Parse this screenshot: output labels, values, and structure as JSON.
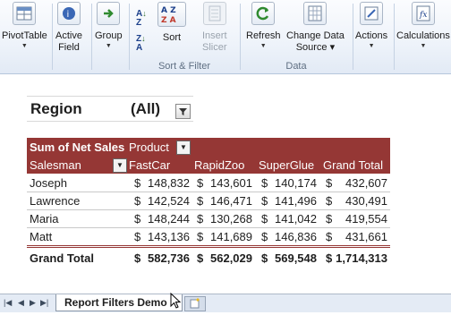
{
  "ribbon": {
    "pivottable": "PivotTable",
    "active_field_1": "Active",
    "active_field_2": "Field",
    "group": "Group",
    "sort": "Sort",
    "insert_slicer_1": "Insert",
    "insert_slicer_2": "Slicer",
    "refresh": "Refresh",
    "change_source_1": "Change Data",
    "change_source_2": "Source",
    "actions": "Actions",
    "calculations": "Calculations",
    "group_sort_filter": "Sort & Filter",
    "group_data": "Data"
  },
  "pivot": {
    "filter_label": "Region",
    "filter_value": "(All)",
    "header_values": "Sum of Net Sales",
    "header_columns": "Product",
    "row_field": "Salesman",
    "columns": [
      "FastCar",
      "RapidZoo",
      "SuperGlue",
      "Grand Total"
    ],
    "currency": "$",
    "rows": [
      {
        "name": "Joseph",
        "values": [
          "148,832",
          "143,601",
          "140,174",
          "432,607"
        ]
      },
      {
        "name": "Lawrence",
        "values": [
          "142,524",
          "146,471",
          "141,496",
          "430,491"
        ]
      },
      {
        "name": "Maria",
        "values": [
          "148,244",
          "130,268",
          "141,042",
          "419,554"
        ]
      },
      {
        "name": "Matt",
        "values": [
          "143,136",
          "141,689",
          "146,836",
          "431,661"
        ]
      }
    ],
    "grand_total_label": "Grand Total",
    "grand_total_values": [
      "582,736",
      "562,029",
      "569,548",
      "1,714,313"
    ]
  },
  "sheet": {
    "active_tab": "Report Filters Demo"
  },
  "colors": {
    "header_bg": "#953735",
    "header_text": "#ffffff"
  }
}
